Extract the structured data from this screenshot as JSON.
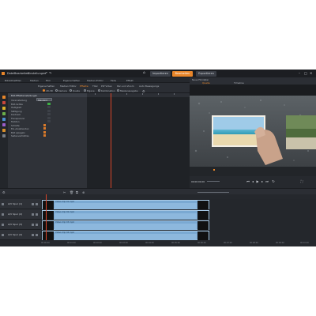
{
  "menu": {
    "items": [
      "Datei",
      "Bearbeiten",
      "Einstellungen"
    ]
  },
  "modes": {
    "tabs": [
      {
        "label": "Importieren"
      },
      {
        "label": "Bearbeiten"
      },
      {
        "label": "Exportieren"
      }
    ]
  },
  "toolbar": {
    "items": [
      "Bibliothek",
      "Titel",
      "Medien",
      "Film",
      "Eigenschaften",
      "Medien-Editor",
      "Fade",
      "Effekt"
    ]
  },
  "subtabs": {
    "items": [
      "Eigenschaften",
      "Medien Editor",
      "Effekte",
      "Titel",
      "PiP Video",
      "Pan und Zoom",
      "Auto Bewegungs"
    ]
  },
  "options": {
    "items": [
      "2D-3D",
      "Kamera",
      "Quelle",
      "Eigene",
      "Kombination",
      "Maskenausgabe"
    ]
  },
  "settings": {
    "header": "Bild-Effekteinstellungen",
    "preset_label": "Voreinstellung",
    "preset_value": "Standard",
    "rows": [
      {
        "label": "Bild-Größe"
      },
      {
        "label": "Helligkeit"
      },
      {
        "label": "Sättigung"
      },
      {
        "label": "Kontrast"
      },
      {
        "label": "Transparenz"
      },
      {
        "label": "Farbton"
      },
      {
        "label": "Schärfe"
      },
      {
        "label": "Ein-/Ausblenden"
      },
      {
        "label": "Bild spiegeln"
      },
      {
        "label": "Seitenverhältnis"
      }
    ]
  },
  "preview": {
    "title": "Neue Filmdatei",
    "tabs": [
      "Quelle",
      "Timeline"
    ],
    "timecode": "00:00:00.00"
  },
  "timeline": {
    "tracks": [
      {
        "name": "A/V Spur (1)",
        "clip": "Video-Clip 01.mp4"
      },
      {
        "name": "A/V Spur (2)",
        "clip": "Video-Clip 02.mp4"
      },
      {
        "name": "A/V Spur (3)",
        "clip": "Video-Clip 03.mp4"
      },
      {
        "name": "A/V Spur (4)",
        "clip": "Video-Clip 04.mp4"
      }
    ],
    "ruler": [
      "00:00:00",
      "00:01:00",
      "00:02:00",
      "00:03:00",
      "00:04:00",
      "00:05:00",
      "00:06:00",
      "00:07:00",
      "00:08:00",
      "00:09:00",
      "00:10:00"
    ]
  },
  "colors": {
    "accent": "#e8862a",
    "playhead": "#d9452a",
    "clip": "#7aa9d2",
    "background": "#2a2d33"
  }
}
